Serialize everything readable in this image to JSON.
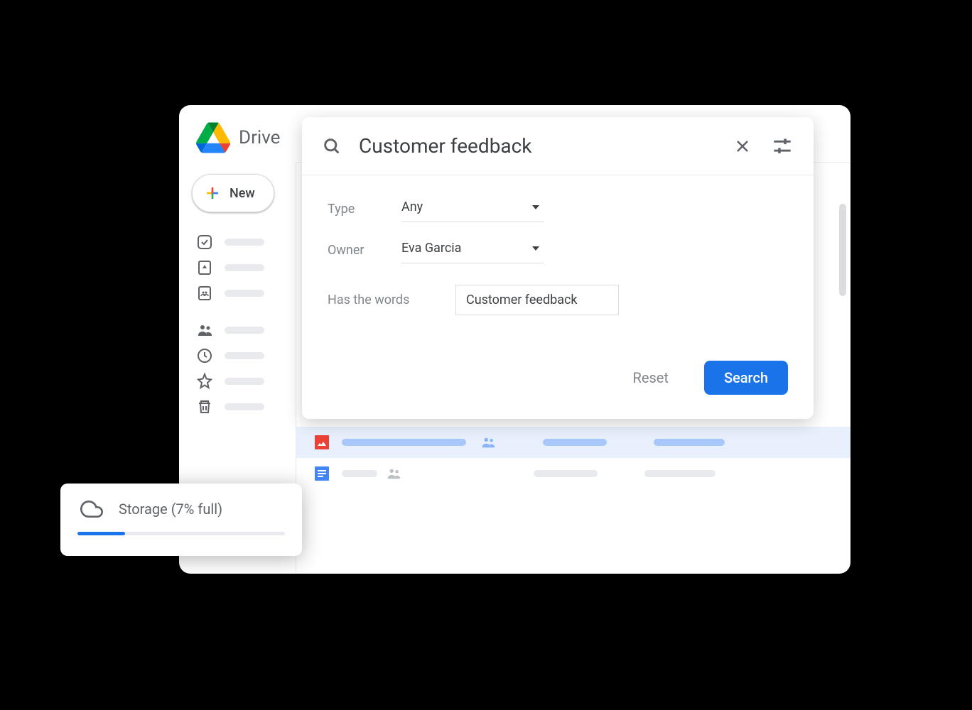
{
  "header": {
    "app_title": "Drive"
  },
  "sidebar": {
    "new_label": "New"
  },
  "search_panel": {
    "query": "Customer feedback",
    "filters": {
      "type_label": "Type",
      "type_value": "Any",
      "owner_label": "Owner",
      "owner_value": "Eva Garcia",
      "words_label": "Has the words",
      "words_value": "Customer feedback"
    },
    "actions": {
      "reset": "Reset",
      "search": "Search"
    }
  },
  "storage": {
    "label": "Storage (7% full)",
    "percent": 7
  },
  "colors": {
    "primary": "#1a73e8",
    "text_grey": "#5f6368",
    "placeholder_grey": "#e8eaed",
    "selected_bg": "#e8f0fe",
    "selected_bar": "#a8c7fa"
  }
}
